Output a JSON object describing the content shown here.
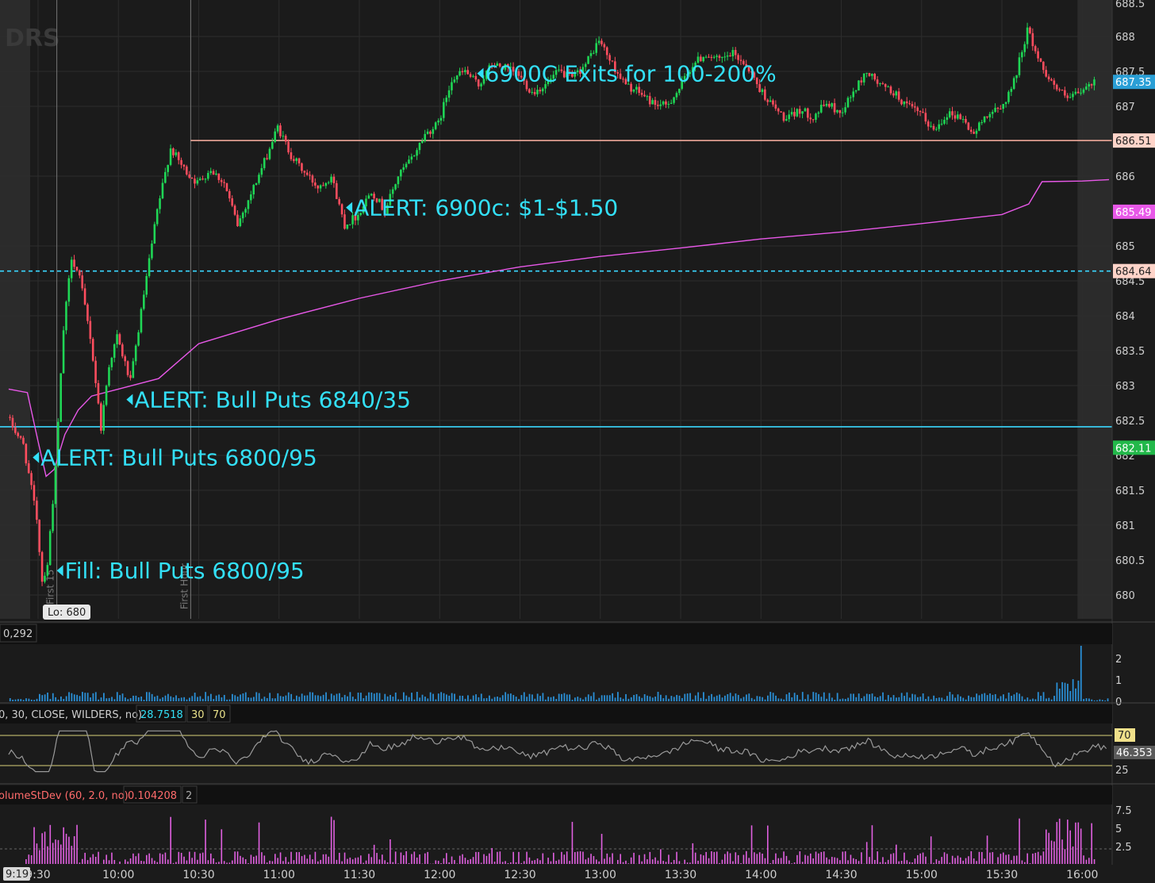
{
  "watermark": "DRS",
  "colors": {
    "background": "#1b1b1b",
    "grid": "#2c2c2c",
    "up_candle": "#1fd655",
    "down_candle": "#ff4d5e",
    "vwap": "#e858e8",
    "cyan": "#3ad7ff",
    "level_line": "#ffb3a3",
    "annotation": "#33e0f7",
    "rsi": "#9a9a9a",
    "rsi_band": "#d8d27a",
    "volume": "#2a8fd6",
    "relvol": "#e060e0"
  },
  "chart_data": {
    "type": "candlestick",
    "time_axis": {
      "ticks": [
        "9:30",
        "10:00",
        "10:30",
        "11:00",
        "11:30",
        "12:00",
        "12:30",
        "13:00",
        "13:30",
        "14:00",
        "14:30",
        "15:00",
        "15:30",
        "16:00"
      ],
      "range": [
        "9:19",
        "16:10"
      ],
      "cursor_label": "9:19"
    },
    "price_axis": {
      "range": [
        679.7,
        688.5
      ],
      "ticks": [
        "680",
        "680.5",
        "681",
        "681.5",
        "682",
        "682.5",
        "683",
        "683.5",
        "684",
        "684.5",
        "685",
        "686",
        "687",
        "687.5",
        "688"
      ],
      "top_partial_label": "688.5"
    },
    "price_path": [
      [
        "9:19",
        682.55
      ],
      [
        "9:25",
        682.15
      ],
      [
        "9:30",
        681.1
      ],
      [
        "9:32",
        680.2
      ],
      [
        "9:34",
        680.45
      ],
      [
        "9:37",
        681.8
      ],
      [
        "9:40",
        683.8
      ],
      [
        "9:43",
        684.85
      ],
      [
        "9:46",
        684.55
      ],
      [
        "9:50",
        683.7
      ],
      [
        "9:54",
        682.4
      ],
      [
        "9:57",
        683.3
      ],
      [
        "10:00",
        683.7
      ],
      [
        "10:05",
        683.05
      ],
      [
        "10:10",
        684.3
      ],
      [
        "10:15",
        685.5
      ],
      [
        "10:20",
        686.4
      ],
      [
        "10:25",
        686.1
      ],
      [
        "10:30",
        685.9
      ],
      [
        "10:35",
        686.1
      ],
      [
        "10:40",
        685.9
      ],
      [
        "10:45",
        685.3
      ],
      [
        "10:50",
        685.75
      ],
      [
        "10:55",
        686.2
      ],
      [
        "11:00",
        686.7
      ],
      [
        "11:05",
        686.3
      ],
      [
        "11:10",
        686.05
      ],
      [
        "11:15",
        685.85
      ],
      [
        "11:20",
        686.0
      ],
      [
        "11:25",
        685.3
      ],
      [
        "11:30",
        685.45
      ],
      [
        "11:35",
        685.8
      ],
      [
        "11:40",
        685.5
      ],
      [
        "11:45",
        686.0
      ],
      [
        "11:50",
        686.25
      ],
      [
        "11:55",
        686.6
      ],
      [
        "12:00",
        686.75
      ],
      [
        "12:05",
        687.4
      ],
      [
        "12:10",
        687.5
      ],
      [
        "12:15",
        687.3
      ],
      [
        "12:20",
        687.6
      ],
      [
        "12:25",
        687.55
      ],
      [
        "12:30",
        687.45
      ],
      [
        "12:35",
        687.2
      ],
      [
        "12:40",
        687.3
      ],
      [
        "12:45",
        687.5
      ],
      [
        "12:50",
        687.4
      ],
      [
        "12:55",
        687.6
      ],
      [
        "13:00",
        687.95
      ],
      [
        "13:05",
        687.6
      ],
      [
        "13:10",
        687.3
      ],
      [
        "13:15",
        687.2
      ],
      [
        "13:20",
        687.05
      ],
      [
        "13:25",
        687.0
      ],
      [
        "13:30",
        687.25
      ],
      [
        "13:35",
        687.6
      ],
      [
        "13:40",
        687.75
      ],
      [
        "13:45",
        687.65
      ],
      [
        "13:50",
        687.75
      ],
      [
        "13:55",
        687.6
      ],
      [
        "14:00",
        687.25
      ],
      [
        "14:05",
        687.0
      ],
      [
        "14:10",
        686.8
      ],
      [
        "14:15",
        686.95
      ],
      [
        "14:20",
        686.85
      ],
      [
        "14:25",
        687.05
      ],
      [
        "14:30",
        686.9
      ],
      [
        "14:35",
        687.2
      ],
      [
        "14:40",
        687.5
      ],
      [
        "14:45",
        687.3
      ],
      [
        "14:50",
        687.2
      ],
      [
        "14:55",
        687.0
      ],
      [
        "15:00",
        686.9
      ],
      [
        "15:05",
        686.65
      ],
      [
        "15:10",
        686.9
      ],
      [
        "15:15",
        686.85
      ],
      [
        "15:20",
        686.6
      ],
      [
        "15:25",
        686.9
      ],
      [
        "15:30",
        686.95
      ],
      [
        "15:35",
        687.35
      ],
      [
        "15:40",
        688.1
      ],
      [
        "15:45",
        687.6
      ],
      [
        "15:50",
        687.3
      ],
      [
        "15:55",
        687.1
      ],
      [
        "16:00",
        687.2
      ],
      [
        "16:05",
        687.35
      ]
    ],
    "vwap_path": [
      [
        "9:19",
        682.95
      ],
      [
        "9:26",
        682.9
      ],
      [
        "9:30",
        682.2
      ],
      [
        "9:33",
        681.7
      ],
      [
        "9:36",
        681.8
      ],
      [
        "9:40",
        682.3
      ],
      [
        "9:45",
        682.65
      ],
      [
        "9:50",
        682.85
      ],
      [
        "10:00",
        682.95
      ],
      [
        "10:15",
        683.1
      ],
      [
        "10:30",
        683.6
      ],
      [
        "11:00",
        683.95
      ],
      [
        "11:30",
        684.25
      ],
      [
        "12:00",
        684.5
      ],
      [
        "12:30",
        684.7
      ],
      [
        "13:00",
        684.85
      ],
      [
        "13:30",
        684.97
      ],
      [
        "14:00",
        685.1
      ],
      [
        "14:30",
        685.2
      ],
      [
        "15:00",
        685.32
      ],
      [
        "15:30",
        685.45
      ],
      [
        "15:40",
        685.6
      ],
      [
        "15:45",
        685.92
      ],
      [
        "16:00",
        685.93
      ],
      [
        "16:10",
        685.95
      ]
    ],
    "levels": [
      {
        "price": 686.51,
        "label": "686.51",
        "style": "solid",
        "color": "#ffb3a3",
        "x_start": "10:27"
      },
      {
        "price": 684.64,
        "label": "684.64",
        "style": "dashed",
        "color": "#3ad7ff"
      },
      {
        "price": 682.41,
        "style": "solid",
        "color": "#3ad7ff"
      }
    ],
    "price_badges": [
      {
        "price": 687.35,
        "label": "687.35",
        "bg": "#2a9fd6",
        "fg": "#ffffff"
      },
      {
        "price": 685.49,
        "label": "685.49",
        "bg": "#e858e8",
        "fg": "#ffffff"
      },
      {
        "price": 682.11,
        "label": "682.11",
        "bg": "#22b84a",
        "fg": "#ffffff"
      }
    ],
    "annotations": [
      {
        "time": "9:28",
        "price": 681.97,
        "text": "ALERT: Bull Puts 6800/95"
      },
      {
        "time": "9:37",
        "price": 680.35,
        "text": "Fill: Bull Puts 6800/95"
      },
      {
        "time": "10:03",
        "price": 682.8,
        "text": "ALERT: Bull Puts 6840/35"
      },
      {
        "time": "11:25",
        "price": 685.55,
        "text": "ALERT: 6900c: $1-$1.50"
      },
      {
        "time": "12:14",
        "price": 687.47,
        "text": "6900C Exits for 100-200%"
      }
    ],
    "low_label": {
      "time": "9:35",
      "text": "Lo: 680"
    },
    "vertical_markers": [
      {
        "time": "9:37",
        "text": "First 15"
      },
      {
        "time": "10:27",
        "text": "First Hour"
      }
    ],
    "premarket_end": "9:30",
    "aftermarket_start": "16:00",
    "volume_panel": {
      "header": "0,292",
      "ticks": [
        "2",
        "1",
        "0"
      ]
    },
    "rsi_panel": {
      "header": "0, 30, CLOSE, WILDERS, no)",
      "value": "28.7518",
      "oversold": "30",
      "overbought": "70",
      "ticks": [
        "70",
        "25"
      ],
      "current": "46.353",
      "band_levels": [
        30,
        70
      ]
    },
    "relvol_panel": {
      "header": "olumeStDev (60, 2.0, no)",
      "value": "0.104208",
      "param": "2",
      "ticks": [
        "7.5",
        "5",
        "2.5"
      ],
      "threshold": 2
    }
  }
}
